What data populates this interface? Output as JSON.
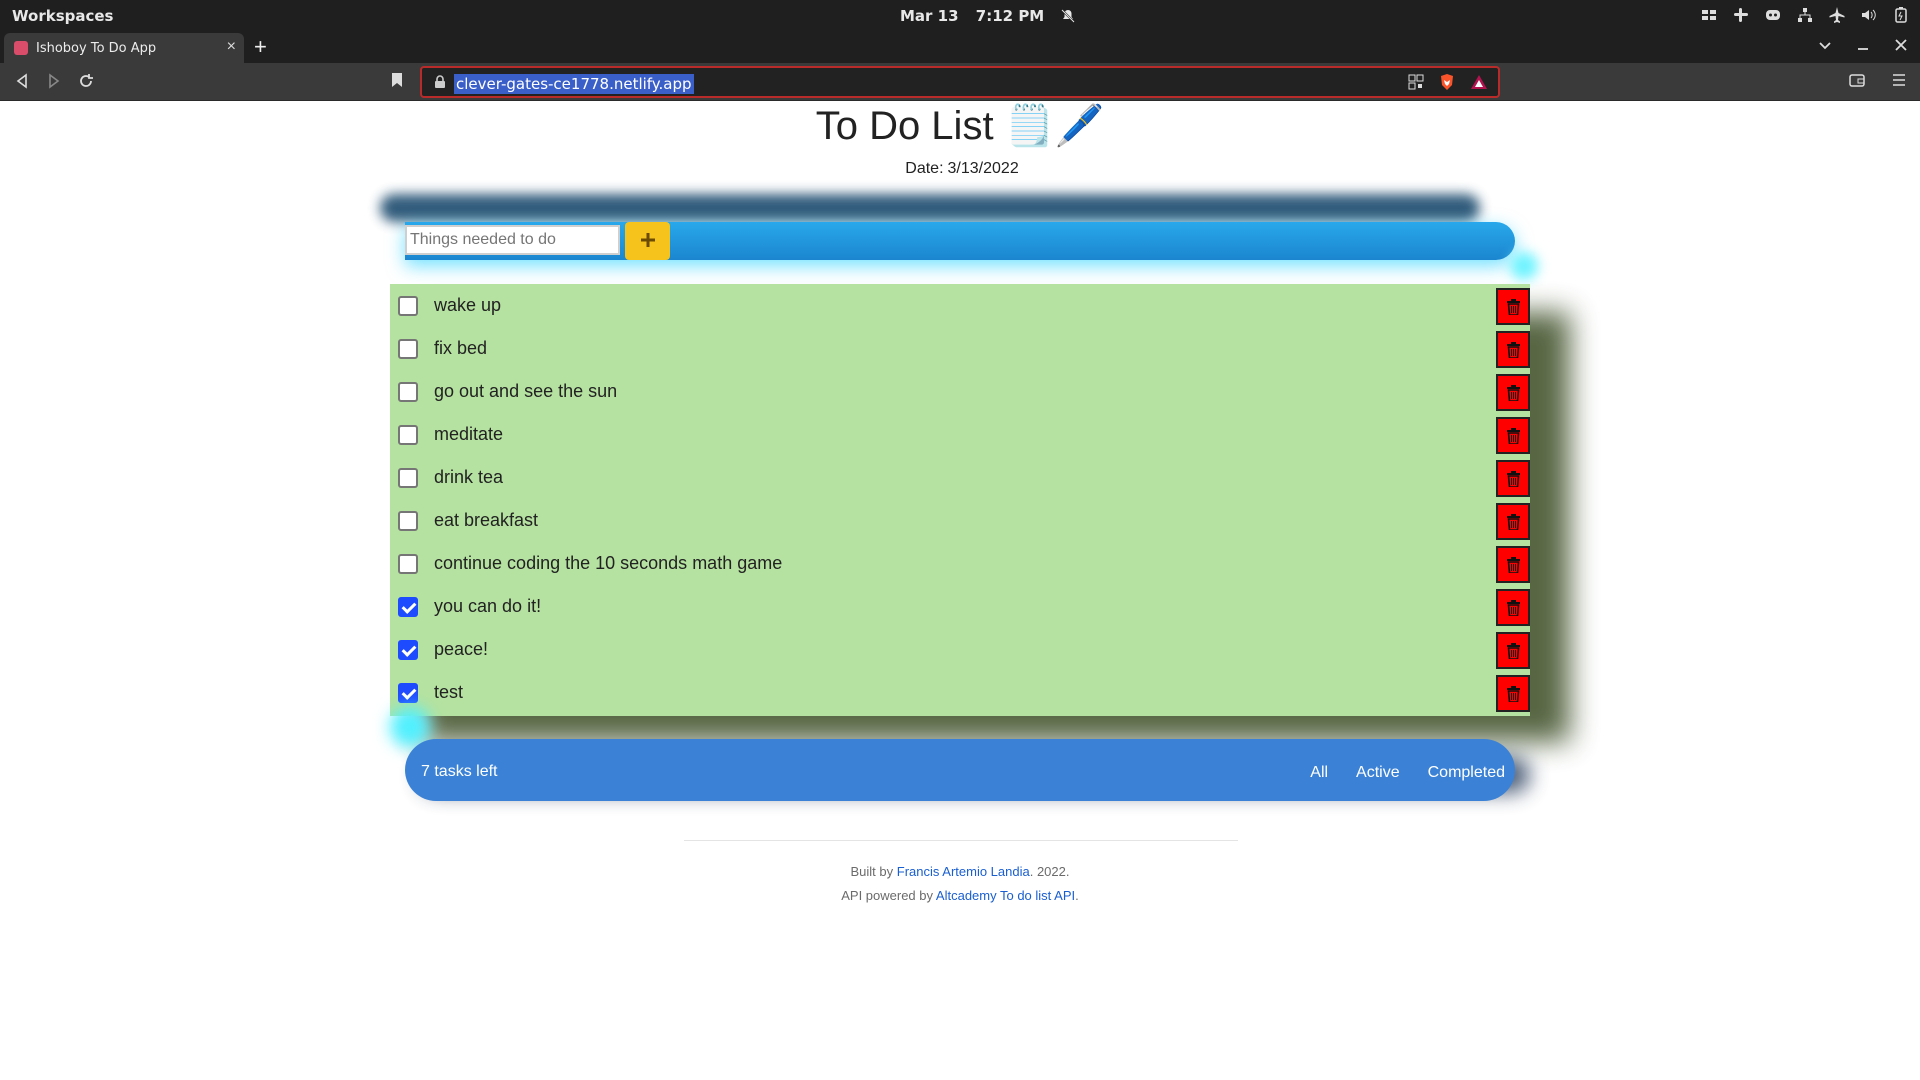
{
  "system": {
    "workspaces": "Workspaces",
    "date": "Mar 13",
    "time": "7:12 PM"
  },
  "browser": {
    "tab_title": "Ishoboy To Do App",
    "url": "clever-gates-ce1778.netlify.app",
    "close_label": "×",
    "newtab_label": "+"
  },
  "app": {
    "title": "To Do List 🗒️🖊️",
    "date_label": "Date:",
    "date_value": "3/13/2022",
    "input_placeholder": "Things needed to do",
    "tasks": [
      {
        "text": "wake up",
        "done": false
      },
      {
        "text": "fix bed",
        "done": false
      },
      {
        "text": "go out and see the sun",
        "done": false
      },
      {
        "text": "meditate",
        "done": false
      },
      {
        "text": "drink tea",
        "done": false
      },
      {
        "text": "eat breakfast",
        "done": false
      },
      {
        "text": "continue coding the 10 seconds math game",
        "done": false
      },
      {
        "text": "you can do it!",
        "done": true
      },
      {
        "text": "peace!",
        "done": true
      },
      {
        "text": "test",
        "done": true
      }
    ],
    "tasks_left": "7 tasks left",
    "filters": {
      "all": "All",
      "active": "Active",
      "completed": "Completed"
    }
  },
  "footer": {
    "built_prefix": "Built by",
    "author": "Francis Artemio Landia",
    "built_suffix": ". 2022.",
    "api_prefix": "API powered by",
    "api_link": "Altcademy To do list API",
    "api_suffix": "."
  },
  "colors": {
    "list_bg": "#b5e2a0",
    "delete_bg": "#ff0000",
    "footer_bar": "#3b82d6",
    "add_button": "#f6c21c",
    "checkbox_checked": "#1f4bff"
  }
}
